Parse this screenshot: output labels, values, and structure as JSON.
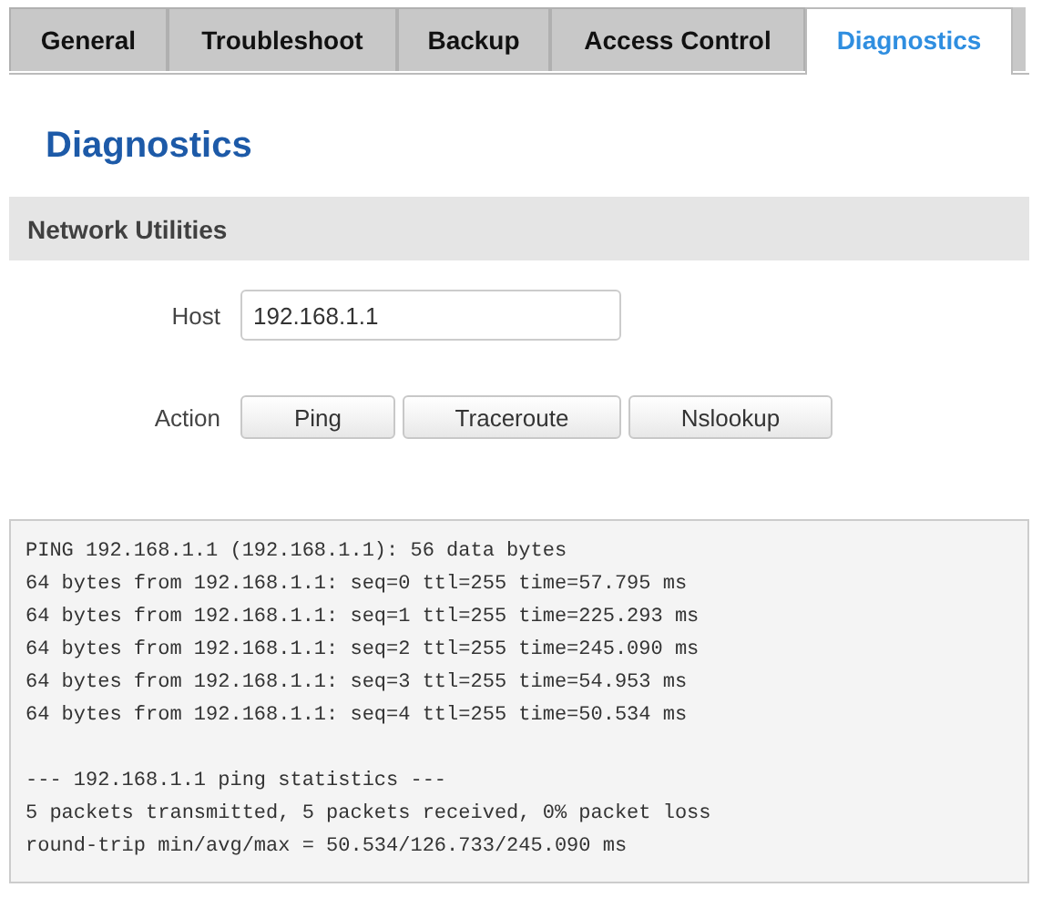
{
  "tabs": [
    {
      "label": "General",
      "selected": false
    },
    {
      "label": "Troubleshoot",
      "selected": false
    },
    {
      "label": "Backup",
      "selected": false
    },
    {
      "label": "Access Control",
      "selected": false
    },
    {
      "label": "Diagnostics",
      "selected": true
    }
  ],
  "page_title": "Diagnostics",
  "section": {
    "title": "Network Utilities",
    "host": {
      "label": "Host",
      "value": "192.168.1.1"
    },
    "action": {
      "label": "Action",
      "buttons": [
        "Ping",
        "Traceroute",
        "Nslookup"
      ]
    }
  },
  "output": "PING 192.168.1.1 (192.168.1.1): 56 data bytes\n64 bytes from 192.168.1.1: seq=0 ttl=255 time=57.795 ms\n64 bytes from 192.168.1.1: seq=1 ttl=255 time=225.293 ms\n64 bytes from 192.168.1.1: seq=2 ttl=255 time=245.090 ms\n64 bytes from 192.168.1.1: seq=3 ttl=255 time=54.953 ms\n64 bytes from 192.168.1.1: seq=4 ttl=255 time=50.534 ms\n\n--- 192.168.1.1 ping statistics ---\n5 packets transmitted, 5 packets received, 0% packet loss\nround-trip min/avg/max = 50.534/126.733/245.090 ms"
}
